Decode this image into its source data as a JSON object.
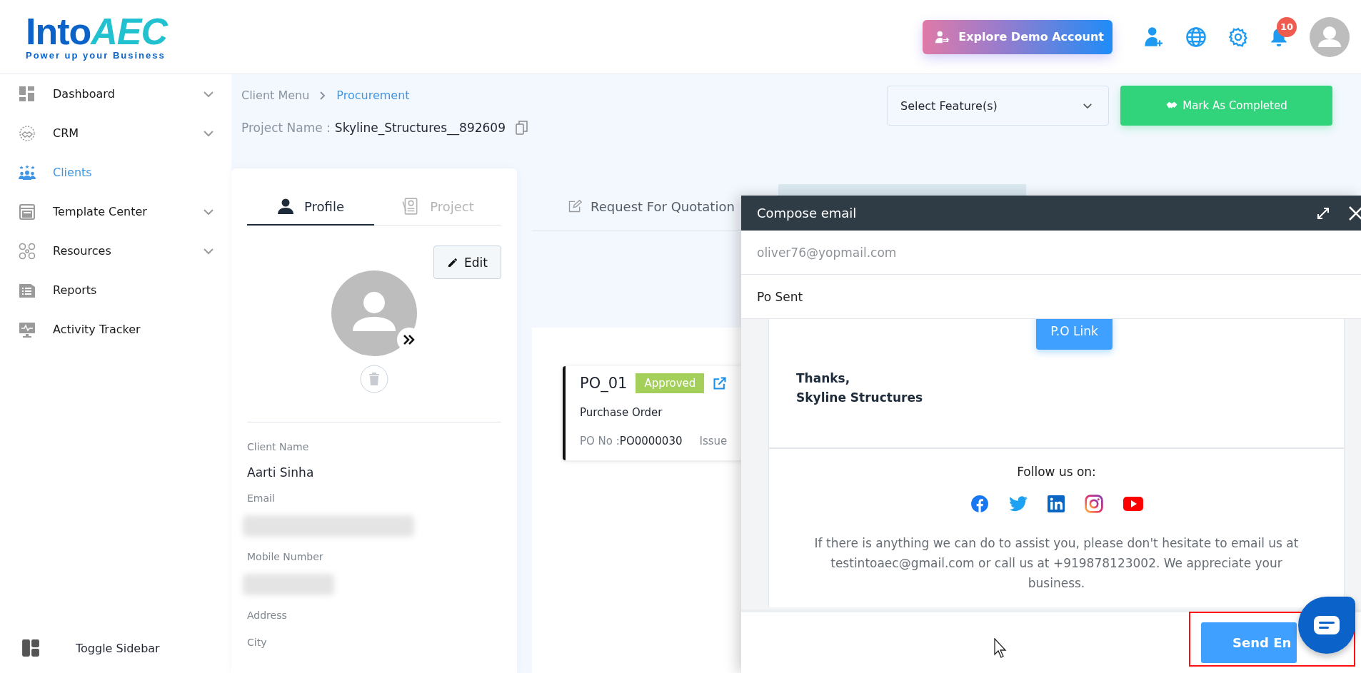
{
  "header": {
    "logo": {
      "word": "Into",
      "accent": "AEC",
      "tagline": "Power up your Business"
    },
    "demo_button": "Explore Demo Account",
    "notification_count": "10"
  },
  "sidebar": {
    "items": [
      {
        "kind": "dashboard",
        "label": "Dashboard",
        "expandable": true,
        "selected": false
      },
      {
        "kind": "crm",
        "label": "CRM",
        "expandable": true,
        "selected": false
      },
      {
        "kind": "clients",
        "label": "Clients",
        "expandable": false,
        "selected": true
      },
      {
        "kind": "template",
        "label": "Template Center",
        "expandable": true,
        "selected": false
      },
      {
        "kind": "resources",
        "label": "Resources",
        "expandable": true,
        "selected": false
      },
      {
        "kind": "reports",
        "label": "Reports",
        "expandable": false,
        "selected": false
      },
      {
        "kind": "activity",
        "label": "Activity Tracker",
        "expandable": false,
        "selected": false
      }
    ],
    "toggle": "Toggle Sidebar"
  },
  "breadcrumb": [
    {
      "label": "Client Menu",
      "current": false
    },
    {
      "label": "Procurement",
      "current": true
    }
  ],
  "project": {
    "label": "Project Name :",
    "value": "Skyline_Structures__892609"
  },
  "feature_select": {
    "placeholder": "Select Feature(s)"
  },
  "complete_button": "Mark As Completed",
  "profile": {
    "tabs": [
      {
        "label": "Profile",
        "selected": true
      },
      {
        "label": "Project",
        "selected": false
      }
    ],
    "edit_button": "Edit",
    "fields": [
      {
        "label": "Client Name",
        "kind": "text",
        "value": "Aarti Sinha"
      },
      {
        "label": "Email",
        "kind": "redacted"
      },
      {
        "label": "Mobile Number",
        "kind": "redacted"
      },
      {
        "label": "Address",
        "kind": "empty"
      },
      {
        "label": "City",
        "kind": "empty"
      }
    ]
  },
  "doc_tabs": [
    {
      "label": "Request For Quotation",
      "selected": false
    }
  ],
  "po_card": {
    "title": "PO_01",
    "status": "Approved",
    "type": "Purchase Order",
    "po_no_label": "PO No :",
    "po_no": "PO0000030",
    "issue_label": "Issue"
  },
  "compose": {
    "title": "Compose email",
    "to": "oliver76@yopmail.com",
    "subject": "Po Sent",
    "link_button": "P.O Link",
    "signoff": [
      "Thanks,",
      "Skyline Structures"
    ],
    "follow": "Follow us on:",
    "socials": [
      {
        "kind": "facebook"
      },
      {
        "kind": "twitter"
      },
      {
        "kind": "linkedin"
      },
      {
        "kind": "instagram"
      },
      {
        "kind": "youtube"
      }
    ],
    "footer_text": "If there is anything we can do to assist you, please don't hesitate to email us at testintoaec@gmail.com or call us at +919878123002. We appreciate your business.",
    "send_button": "Send En"
  }
}
